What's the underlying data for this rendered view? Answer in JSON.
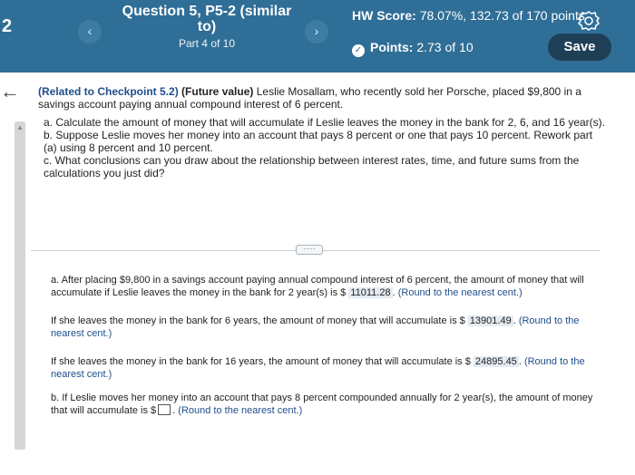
{
  "header": {
    "question_number": "2",
    "title": "Question 5, P5-2 (similar to)",
    "part": "Part 4 of 10",
    "hw_score_label": "HW Score:",
    "hw_score_value": "78.07%, 132.73 of 170 points",
    "points_label": "Points:",
    "points_value": "2.73 of 10",
    "save_label": "Save",
    "prev_glyph": "‹",
    "next_glyph": "›",
    "icons": {
      "settings": "gear-icon",
      "status": "check-circle-icon",
      "back": "back-arrow-icon"
    }
  },
  "question": {
    "tag": "(Related to Checkpoint 5.2)",
    "topic": "(Future value)",
    "body": "Leslie Mosallam, who recently sold her Porsche, placed $9,800 in a savings account paying annual compound interest of 6 percent.",
    "task_a": "a. Calculate the amount of money that will accumulate if Leslie leaves the money in the bank for 2, 6, and 16 year(s).",
    "task_b": "b. Suppose Leslie moves her money into an account that pays 8 percent or one that pays 10 percent. Rework part (a) using 8 percent and 10 percent.",
    "task_c": "c. What conclusions can you draw about the relationship between interest rates, time, and future sums from the calculations you just did?"
  },
  "divider_button_label": "·····",
  "answers": {
    "a1_text": "a. After placing $9,800 in a savings account paying annual compound interest of 6 percent, the amount of money that will accumulate if Leslie leaves the money in the bank for 2 year(s) is $",
    "a1_value": "11011.28",
    "a1_hint": "(Round to the nearest cent.)",
    "a2_text": "If she leaves the money in the bank for 6 years, the amount of money that will accumulate is $",
    "a2_value": "13901.49",
    "a2_hint": "(Round to the nearest cent.)",
    "a3_text": "If she leaves the money in the bank for 16 years, the amount of money that will accumulate is $",
    "a3_value": "24895.45",
    "a3_hint": "(Round to the nearest cent.)",
    "b1_text": "b. If Leslie moves her money into an account that pays 8 percent compounded annually for 2 year(s), the amount of money that will accumulate is $",
    "b1_value": "",
    "b1_hint": "(Round to the nearest cent.)"
  }
}
